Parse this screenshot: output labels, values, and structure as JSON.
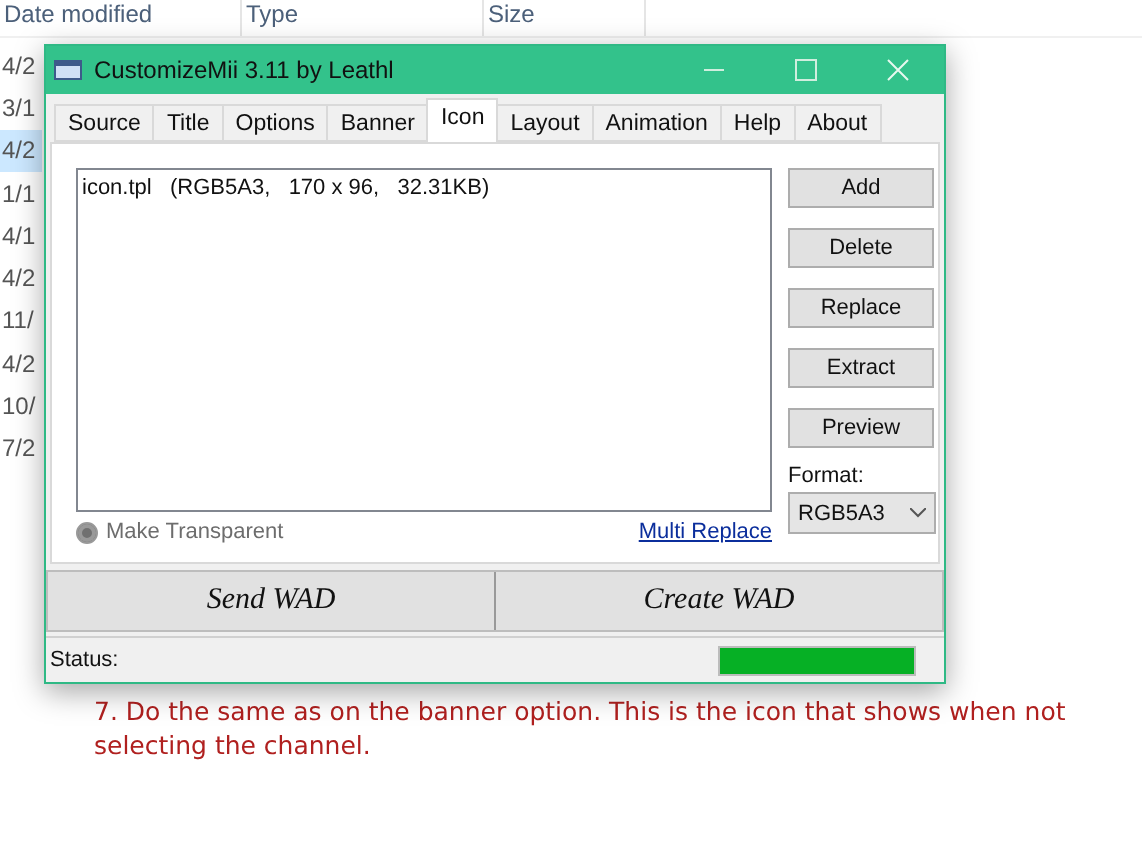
{
  "explorer": {
    "columns": [
      "Date modified",
      "Type",
      "Size"
    ],
    "rows": [
      {
        "date": "4/2",
        "selected": false
      },
      {
        "date": "3/1",
        "selected": false
      },
      {
        "date": "4/2",
        "selected": true
      },
      {
        "date": "1/1",
        "selected": false
      },
      {
        "date": "4/1",
        "selected": false
      },
      {
        "date": "4/2",
        "selected": false
      },
      {
        "date": "11/",
        "selected": false
      },
      {
        "date": "4/2",
        "selected": false
      },
      {
        "date": "10/",
        "selected": false
      },
      {
        "date": "7/2",
        "selected": false
      }
    ]
  },
  "window": {
    "title": "CustomizeMii 3.11 by Leathl"
  },
  "tabs": [
    {
      "label": "Source",
      "selected": false
    },
    {
      "label": "Title",
      "selected": false
    },
    {
      "label": "Options",
      "selected": false
    },
    {
      "label": "Banner",
      "selected": false
    },
    {
      "label": "Icon",
      "selected": true
    },
    {
      "label": "Layout",
      "selected": false
    },
    {
      "label": "Animation",
      "selected": false
    },
    {
      "label": "Help",
      "selected": false
    },
    {
      "label": "About",
      "selected": false
    }
  ],
  "list": {
    "items": [
      "icon.tpl   (RGB5A3,   170 x 96,   32.31KB)"
    ]
  },
  "side_buttons": [
    "Add",
    "Delete",
    "Replace",
    "Extract",
    "Preview"
  ],
  "format": {
    "label": "Format:",
    "value": "RGB5A3"
  },
  "make_transparent": {
    "label": "Make Transparent",
    "disabled": true
  },
  "multi_replace": "Multi Replace",
  "big_buttons": [
    "Send WAD",
    "Create WAD"
  ],
  "status": {
    "label": "Status:",
    "level": 1
  },
  "caption": "7. Do the same as on the banner option. This is the icon that shows when not selecting the channel."
}
